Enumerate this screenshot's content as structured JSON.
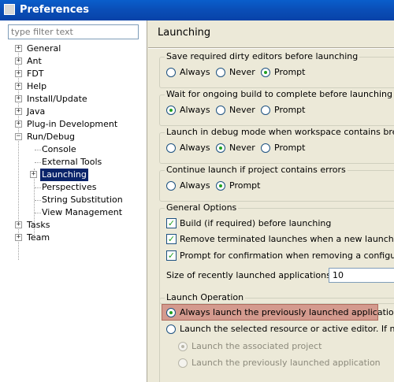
{
  "window": {
    "title": "Preferences"
  },
  "filter": {
    "placeholder": "type filter text"
  },
  "tree": {
    "items": [
      {
        "label": "General",
        "expanded": false
      },
      {
        "label": "Ant",
        "expanded": false
      },
      {
        "label": "FDT",
        "expanded": false
      },
      {
        "label": "Help",
        "expanded": false
      },
      {
        "label": "Install/Update",
        "expanded": false
      },
      {
        "label": "Java",
        "expanded": false
      },
      {
        "label": "Plug-in Development",
        "expanded": false
      },
      {
        "label": "Run/Debug",
        "expanded": true,
        "children": [
          {
            "label": "Console"
          },
          {
            "label": "External Tools"
          },
          {
            "label": "Launching",
            "selected": true
          },
          {
            "label": "Perspectives"
          },
          {
            "label": "String Substitution"
          },
          {
            "label": "View Management"
          }
        ]
      },
      {
        "label": "Tasks",
        "expanded": false
      },
      {
        "label": "Team",
        "expanded": false
      }
    ]
  },
  "page": {
    "title": "Launching",
    "groups": {
      "save_dirty": {
        "title": "Save required dirty editors before launching",
        "options": [
          "Always",
          "Never",
          "Prompt"
        ],
        "selected": "Prompt"
      },
      "wait_build": {
        "title": "Wait for ongoing build to complete before launching",
        "options": [
          "Always",
          "Never",
          "Prompt"
        ],
        "selected": "Always"
      },
      "debug_mode": {
        "title": "Launch in debug mode when workspace contains breakpoints",
        "options": [
          "Always",
          "Never",
          "Prompt"
        ],
        "selected": "Never"
      },
      "continue_errors": {
        "title": "Continue launch if project contains errors",
        "options": [
          "Always",
          "Prompt"
        ],
        "selected": "Prompt"
      },
      "general": {
        "title": "General Options",
        "checks": [
          {
            "label": "Build (if required) before launching",
            "checked": true
          },
          {
            "label": "Remove terminated launches when a new launch is create",
            "checked": true
          },
          {
            "label": "Prompt for confirmation when removing a configuration fr",
            "checked": true
          }
        ],
        "recent_label": "Size of recently launched applications list:",
        "recent_value": "10"
      },
      "launch_op": {
        "title": "Launch Operation",
        "opt_previous": "Always launch the previously launched application",
        "opt_selected": "Launch the selected resource or active editor. If not laun",
        "sub_project": "Launch the associated project",
        "sub_previous": "Launch the previously launched application",
        "selected": "opt_previous"
      }
    }
  },
  "colors": {
    "selection": "#0a246a",
    "highlight": "#d49a8e",
    "radio_dot": "#21a121",
    "title_bar": "#0a4fb8"
  }
}
